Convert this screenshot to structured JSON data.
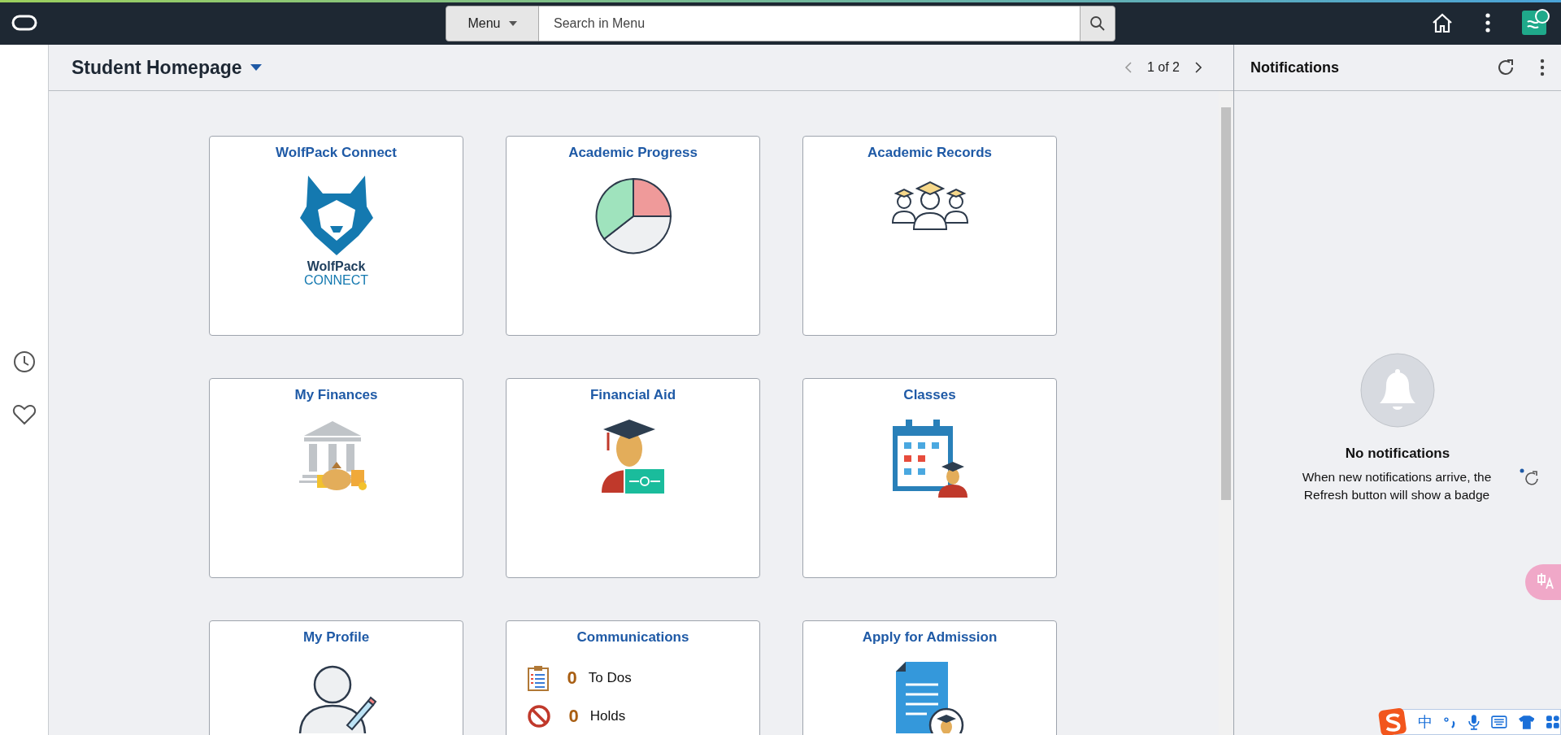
{
  "topbar": {
    "menu_button": "Menu",
    "search": {
      "placeholder": "Search in Menu"
    }
  },
  "header": {
    "title": "Student Homepage",
    "pager": "1 of 2"
  },
  "tiles": [
    {
      "title": "WolfPack Connect",
      "kind": "wolfpack",
      "logo_lines": [
        "WolfPack",
        "CONNECT"
      ]
    },
    {
      "title": "Academic Progress",
      "kind": "progress"
    },
    {
      "title": "Academic Records",
      "kind": "records"
    },
    {
      "title": "My Finances",
      "kind": "finances"
    },
    {
      "title": "Financial Aid",
      "kind": "aid"
    },
    {
      "title": "Classes",
      "kind": "classes"
    },
    {
      "title": "My Profile",
      "kind": "profile"
    },
    {
      "title": "Communications",
      "kind": "communications",
      "items": [
        {
          "kind": "todo",
          "count": "0",
          "label": "To Dos"
        },
        {
          "kind": "holds",
          "count": "0",
          "label": "Holds"
        }
      ]
    },
    {
      "title": "Apply for Admission",
      "kind": "admission"
    }
  ],
  "notifications": {
    "title": "Notifications",
    "empty_title": "No notifications",
    "empty_text": "When new notifications arrive, the Refresh button will show a badge"
  },
  "ime": {
    "mode": "中"
  }
}
